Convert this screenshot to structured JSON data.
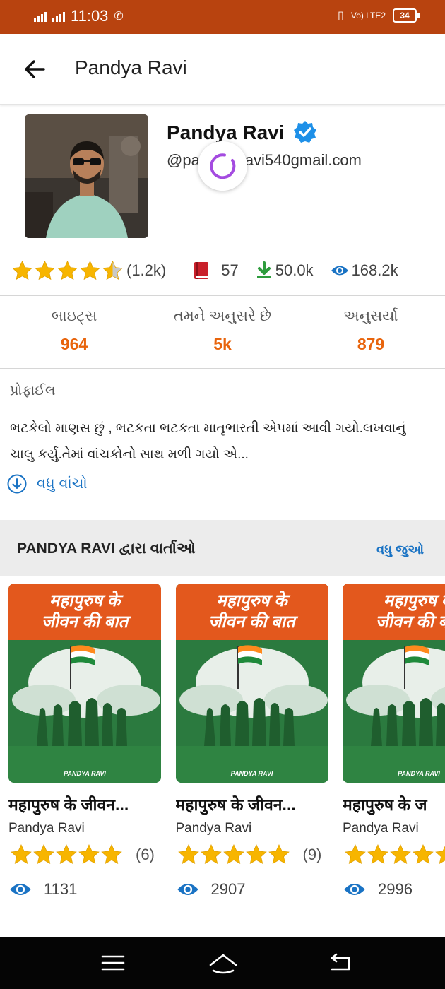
{
  "status_bar": {
    "time": "11:03",
    "network": "Vo) LTE2",
    "battery": "34"
  },
  "app_bar": {
    "title": "Pandya Ravi"
  },
  "profile": {
    "name": "Pandya Ravi",
    "handle_start": "@pa",
    "handle_end": "avi540gmail.com",
    "rating": 4.5,
    "rating_count": "(1.2k)",
    "books": "57",
    "downloads": "50.0k",
    "views": "168.2k"
  },
  "counts": [
    {
      "label": "બાઇટ્સ",
      "value": "964"
    },
    {
      "label": "તમને અનુસરે છે",
      "value": "5k"
    },
    {
      "label": "અનુસર્યા",
      "value": "879"
    }
  ],
  "about": {
    "heading": "પ્રોફાઈલ",
    "bio_line1": "ભટકેલો માણસ છું , ભટકતા ભટકતા માતૃભારતી એપમાં આવી ગયો.લખવાનું",
    "bio_line2": "ચાલુ કર્યુ.તેમાં વાંચકોનો સાથ મળી ગયો એ...",
    "read_more": "વધુ વાંચો"
  },
  "stories": {
    "title": "PANDYA RAVI દ્વારા વાર્તાઓ",
    "see_more": "વધુ જુઓ",
    "items": [
      {
        "cover_line1": "महापुरुष के",
        "cover_line2": "जीवन की बात",
        "cover_author": "PANDYA RAVI",
        "title": "महापुरुष के जीवन...",
        "author": "Pandya Ravi",
        "rating": 5,
        "rating_count": "(6)",
        "views": "1131"
      },
      {
        "cover_line1": "महापुरुष के",
        "cover_line2": "जीवन की बात",
        "cover_author": "PANDYA RAVI",
        "title": "महापुरुष के जीवन...",
        "author": "Pandya Ravi",
        "rating": 5,
        "rating_count": "(9)",
        "views": "2907"
      },
      {
        "cover_line1": "महापुरुष के",
        "cover_line2": "जीवन की बात",
        "cover_author": "PANDYA RAVI",
        "title": "महापुरुष के ज",
        "author": "Pandya Ravi",
        "rating": 5,
        "rating_count": "",
        "views": "2996"
      }
    ]
  },
  "colors": {
    "status_bar": "#b8430f",
    "accent_orange": "#e8640c",
    "link_blue": "#1a73c4",
    "star": "#f7b500",
    "cover_orange": "#e3581d",
    "cover_green": "#2b7a3f"
  },
  "icons": [
    "back-arrow-icon",
    "verified-badge-icon",
    "star-icon",
    "book-icon",
    "download-icon",
    "eye-icon",
    "arrow-down-circle-icon",
    "menu-icon",
    "home-icon",
    "back-nav-icon"
  ]
}
